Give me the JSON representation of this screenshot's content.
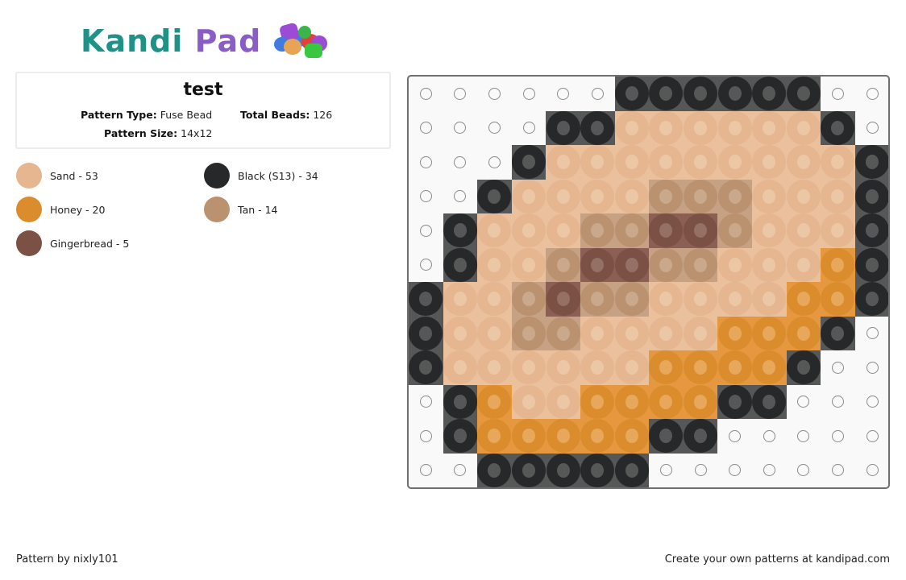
{
  "logo": {
    "part1": "Kandi",
    "part2": "Pad",
    "icon": "bead-pile-icon"
  },
  "pattern": {
    "title": "test",
    "type_label": "Pattern Type:",
    "type_value": "Fuse Bead",
    "beads_label": "Total Beads:",
    "beads_value": "126",
    "size_label": "Pattern Size:",
    "size_value": "14x12"
  },
  "colors": {
    "S": {
      "name": "Sand",
      "count": 53,
      "label": "Sand - 53",
      "hex": "#e5b690",
      "bg": "#eac09d",
      "hole": "#ecc7a6"
    },
    "K": {
      "name": "Black (S13)",
      "count": 34,
      "label": "Black (S13) - 34",
      "hex": "#27282a",
      "bg": "#555857",
      "hole": "#555857"
    },
    "H": {
      "name": "Honey",
      "count": 20,
      "label": "Honey - 20",
      "hex": "#db8d2e",
      "bg": "#e5983f",
      "hole": "#e7a85c"
    },
    "T": {
      "name": "Tan",
      "count": 14,
      "label": "Tan - 14",
      "hex": "#bb9270",
      "bg": "#c7a183",
      "hole": "#c9a88b"
    },
    "G": {
      "name": "Gingerbread",
      "count": 5,
      "label": "Gingerbread - 5",
      "hex": "#7b5045",
      "bg": "#8b5f54",
      "hole": "#957065"
    }
  },
  "legend": [
    "S",
    "K",
    "H",
    "T",
    "G"
  ],
  "grid": {
    "cols": 14,
    "rows": 12,
    "empty": "E",
    "cells": [
      "EEEEEEKKKKKKEE",
      "EEEEKKSSSSSSKE",
      "EEEKSSSSSSSSSK",
      "EEKSSSSTTTSSSK",
      "EKSSSTTGGTSSSK",
      "EKSSTGGTTSSSHK",
      "KSSTGTTSSSSHHK",
      "KSSTTSSSSHHHKE",
      "KSSSSSSHHHHKEE",
      "EKHSSHHHHKKEEE",
      "EKHHHHHKKEEEEE",
      "EEKKKKKEEEEEEE"
    ]
  },
  "footer": {
    "author": "Pattern by nixly101",
    "promo": "Create your own patterns at kandipad.com"
  }
}
